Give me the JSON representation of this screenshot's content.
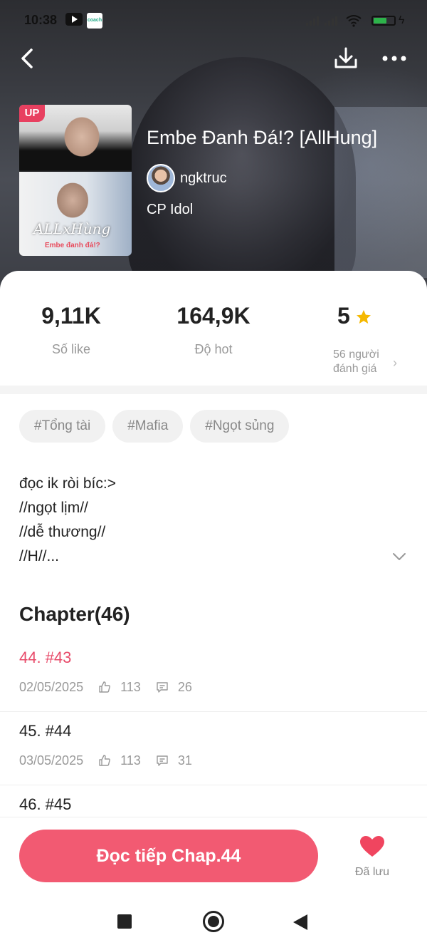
{
  "status_bar": {
    "time": "10:38",
    "coach_icon_text": "coach"
  },
  "header": {
    "up_badge": "UP",
    "title": "Embe Đanh Đá!? [AllHung]",
    "author": "ngktruc",
    "category": "CP Idol",
    "cover_title": "ALLxHùng",
    "cover_subtitle": "Embe đanh đá!?"
  },
  "stats": {
    "likes_value": "9,11K",
    "likes_label": "Số like",
    "hot_value": "164,9K",
    "hot_label": "Độ hot",
    "rating_value": "5",
    "rating_label": "56 người đánh giá"
  },
  "tags": [
    "#Tổng tài",
    "#Mafia",
    "#Ngọt sủng"
  ],
  "description": [
    "đọc ik ròi bíc:>",
    "//ngọt lịm//",
    "//dễ thương//",
    "//H//..."
  ],
  "chapters_heading": "Chapter(46)",
  "chapters": [
    {
      "title": "44. #43",
      "date": "02/05/2025",
      "likes": "113",
      "comments": "26"
    },
    {
      "title": "45. #44",
      "date": "03/05/2025",
      "likes": "113",
      "comments": "31"
    },
    {
      "title": "46. #45",
      "date": "",
      "likes": "",
      "comments": ""
    }
  ],
  "action_bar": {
    "read_button": "Đọc tiếp Chap.44",
    "saved_label": "Đã lưu"
  },
  "colors": {
    "accent": "#f25a72",
    "active_chapter": "#e84b6a",
    "star": "#f5b800",
    "heart": "#f0455f"
  }
}
